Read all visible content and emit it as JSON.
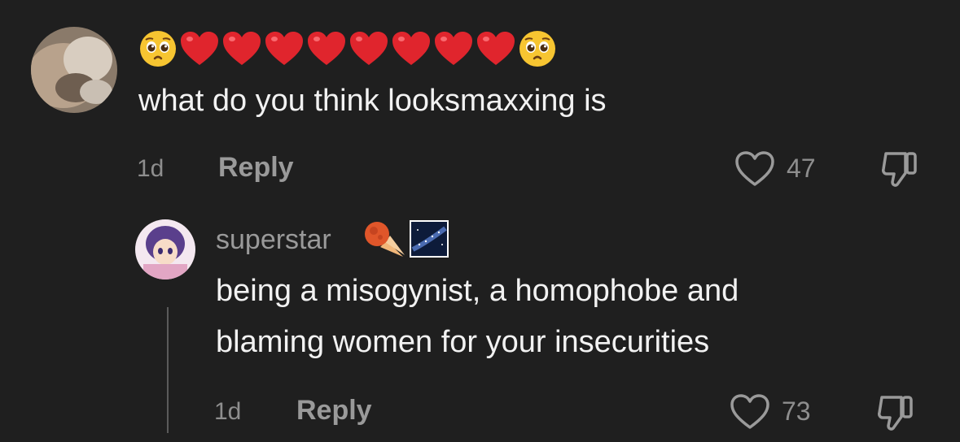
{
  "comment": {
    "emojis": [
      "pleading-face",
      "red-heart",
      "red-heart",
      "red-heart",
      "red-heart",
      "red-heart",
      "red-heart",
      "red-heart",
      "red-heart",
      "pleading-face"
    ],
    "text": "what do you think looksmaxxing is",
    "time": "1d",
    "reply_label": "Reply",
    "likes": "47"
  },
  "reply": {
    "username": "superstar",
    "badges": [
      "meteor-emoji",
      "milky-way-emoji"
    ],
    "text_line1": "being a misogynist, a homophobe and",
    "text_line2": "blaming women for your insecurities",
    "time": "1d",
    "reply_label": "Reply",
    "likes": "73"
  },
  "colors": {
    "background": "#1f1f1f",
    "primary_text": "#f2f2f2",
    "secondary_text": "#8e8e8e",
    "heart_red": "#e0252d"
  }
}
